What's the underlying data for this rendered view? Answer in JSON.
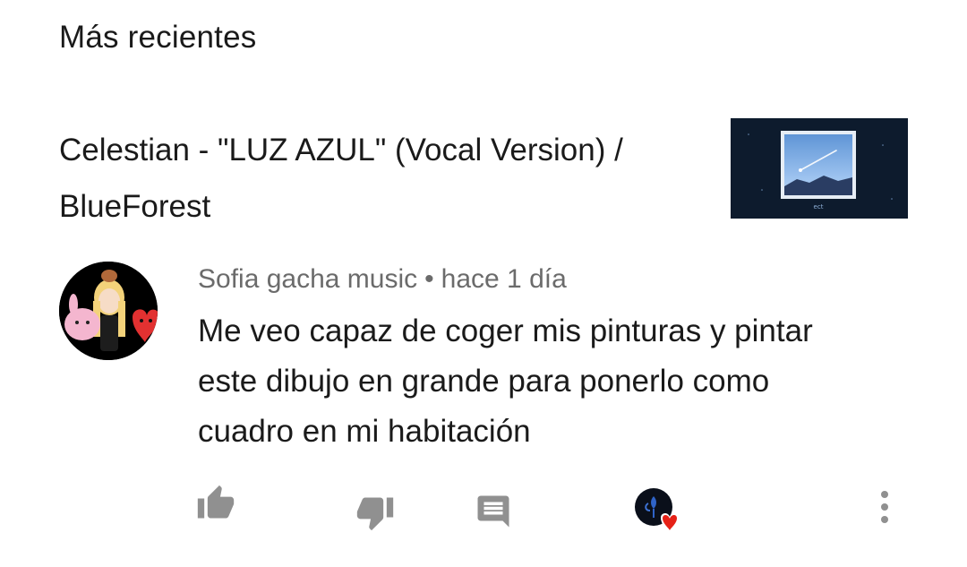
{
  "sort": {
    "label": "Más recientes"
  },
  "video": {
    "title": "Celestian - \"LUZ AZUL\" (Vocal Version) / BlueForest",
    "thumbnail_icon": "album-cover-thumbnail",
    "thumbnail_caption": "ect"
  },
  "comment": {
    "author": "Sofia gacha music",
    "separator": "•",
    "time": "hace 1 día",
    "text": "Me veo capaz de coger mis pinturas y pintar este dibujo en grande para ponerlo como cuadro en mi habitación",
    "avatar_icon": "user-avatar"
  },
  "actions": {
    "like_icon": "thumb-up-icon",
    "dislike_icon": "thumb-down-icon",
    "reply_icon": "reply-comment-icon",
    "creator_heart_icon": "creator-heart-icon",
    "more_icon": "more-vertical-icon"
  },
  "colors": {
    "icon_gray": "#909090",
    "heart_red": "#e62117",
    "meta_gray": "#6b6b6b"
  }
}
